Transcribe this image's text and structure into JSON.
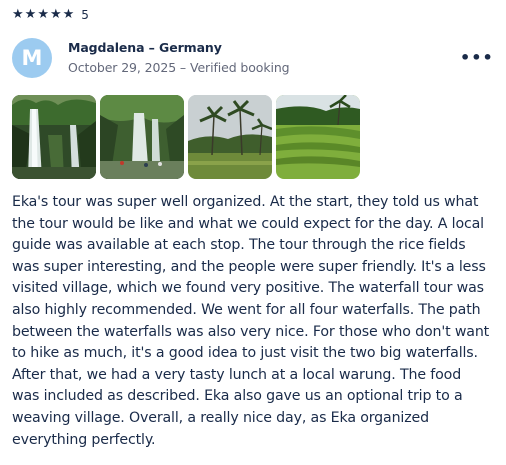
{
  "rating": {
    "stars": 5,
    "value": "5",
    "star_glyph": "★"
  },
  "reviewer": {
    "initial": "M",
    "name": "Magdalena – Germany",
    "meta": "October 29, 2025 – Verified booking",
    "avatar_color": "#9ccbf0"
  },
  "actions": {
    "more_glyph": "•••",
    "more_icon": "more-options-icon"
  },
  "photos": [
    {
      "subject": "twin waterfalls in jungle"
    },
    {
      "subject": "waterfall with people at base"
    },
    {
      "subject": "palm trees and rice field under cloudy sky"
    },
    {
      "subject": "terraced rice fields with palms"
    }
  ],
  "review": {
    "text": "Eka's tour was super well organized. At the start, they told us what the tour would be like and what we could expect for the day. A local guide was available at each stop. The tour through the rice fields was super interesting, and the people were super friendly. It's a less visited village, which we found very positive. The waterfall tour was also highly recommended. We went for all four waterfalls. The path between the waterfalls was also very nice. For those who don't want to hike as much, it's a good idea to just visit the two big waterfalls. After that, we had a very tasty lunch at a local warung. The food was included as described. Eka also gave us an optional trip to a weaving village. Overall, a really nice day, as Eka organized everything perfectly."
  },
  "colors": {
    "text": "#1a2b49",
    "muted": "#63687a"
  }
}
